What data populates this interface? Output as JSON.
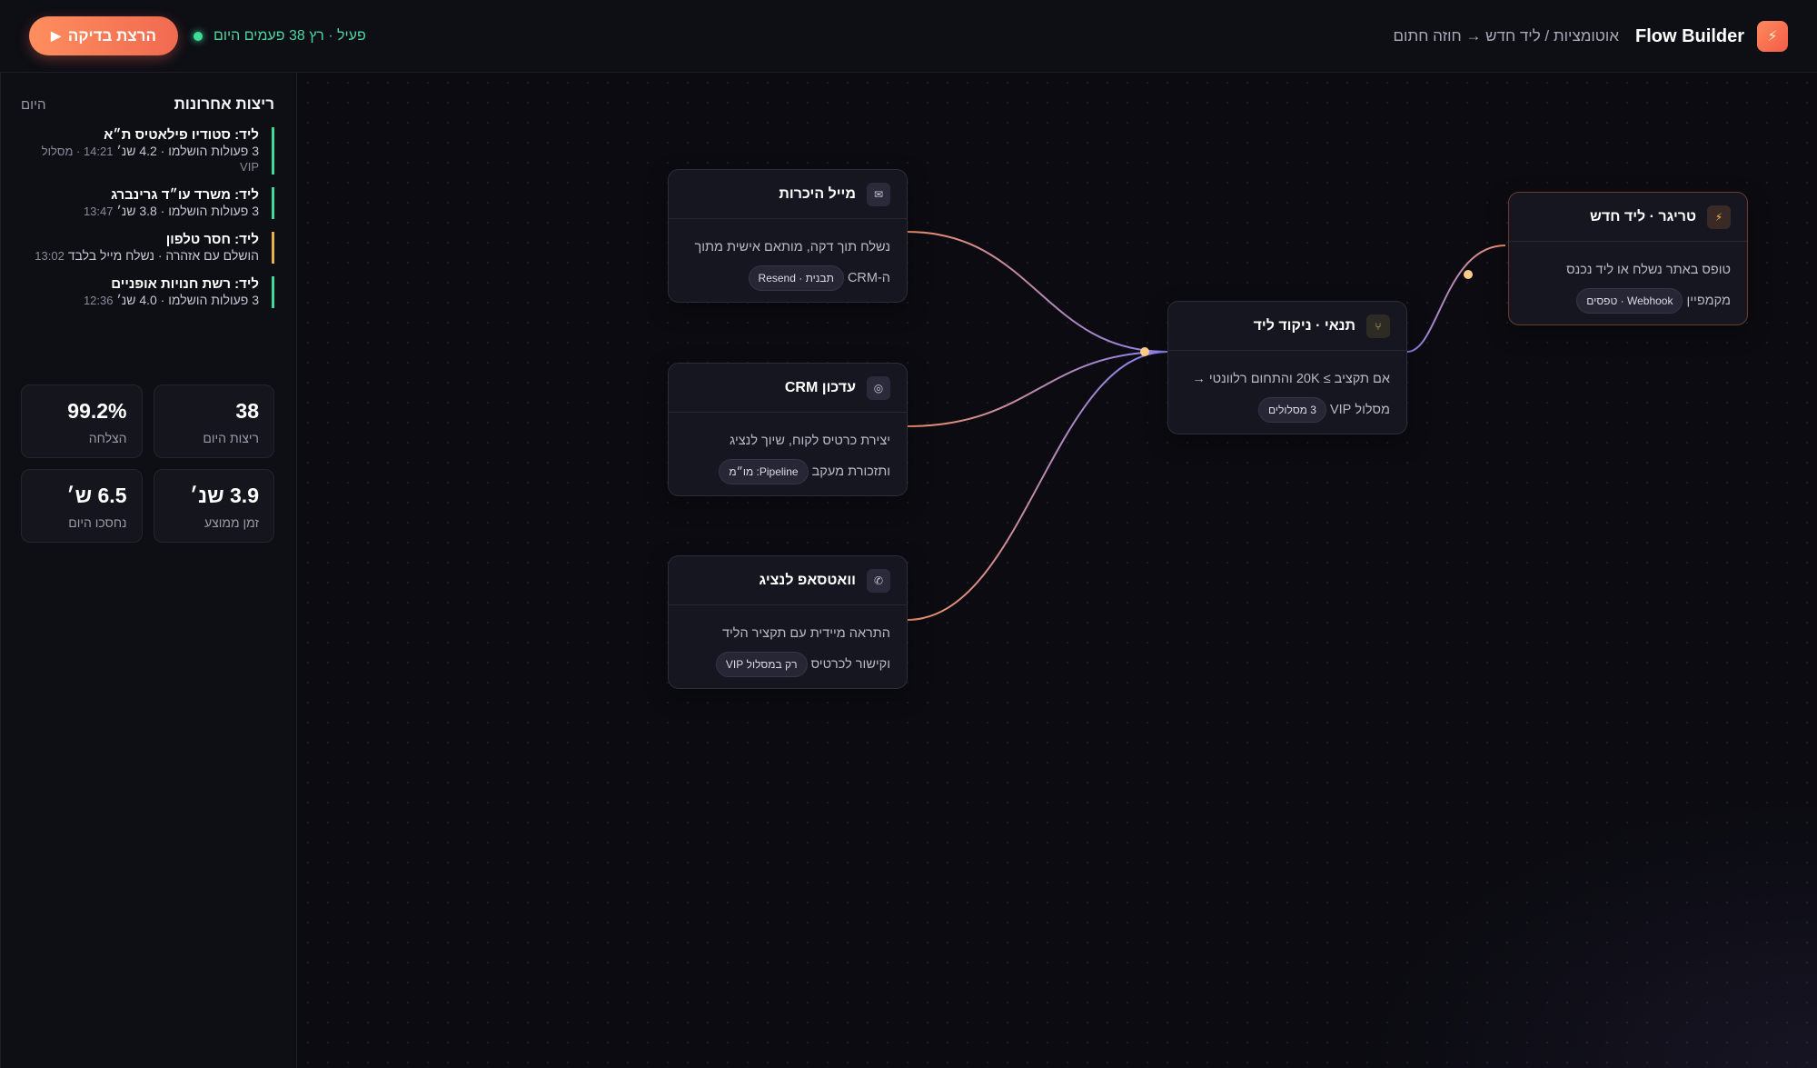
{
  "header": {
    "brand_title": "Flow Builder",
    "brand_icon": "bolt-icon",
    "breadcrumb": "אוטומציות / ליד חדש → חוזה חתום",
    "status_text": "פעיל · רץ 38 פעמים היום",
    "run_button": "הרצת בדיקה",
    "accent_color": "#f06a50",
    "status_color": "#3ddc97"
  },
  "sidebar": {
    "title": "ריצות אחרונות",
    "today": "היום",
    "runs": [
      {
        "name": "ליד: סטודיו פילאטיס ת״א",
        "meta": "3 פעולות הושלמו · 4.2 שנ׳",
        "time": "14:21 · מסלול VIP",
        "status": "success"
      },
      {
        "name": "ליד: משרד עו״ד גרינברג",
        "meta": "3 פעולות הושלמו · 3.8 שנ׳",
        "time": "13:47",
        "status": "success"
      },
      {
        "name": "ליד: חסר טלפון",
        "meta": "הושלם עם אזהרה · נשלח מייל בלבד",
        "time": "13:02",
        "status": "warning"
      },
      {
        "name": "ליד: רשת חנויות אופניים",
        "meta": "3 פעולות הושלמו · 4.0 שנ׳",
        "time": "12:36",
        "status": "success"
      }
    ],
    "stats": [
      {
        "value": "38",
        "label": "ריצות היום"
      },
      {
        "value": "99.2%",
        "label": "הצלחה"
      },
      {
        "value": "3.9 שנ׳",
        "label": "זמן ממוצע"
      },
      {
        "value": "6.5 ש׳",
        "label": "נחסכו היום"
      }
    ]
  },
  "nodes": {
    "trigger": {
      "icon": "bolt-icon",
      "title": "טריגר · ליד חדש",
      "line1": "טופס באתר נשלח או ליד נכנס",
      "line2": "מקמפיין",
      "pill": "Webhook · טפסים"
    },
    "condition": {
      "icon": "branch-icon",
      "title": "תנאי · ניקוד ליד",
      "line1": "אם תקציב ≥ 20K והתחום רלוונטי →",
      "line2": "מסלול VIP",
      "pill": "3 מסלולים"
    },
    "email": {
      "icon": "mail-icon",
      "title": "מייל היכרות",
      "line1": "נשלח תוך דקה, מותאם אישית מתוך",
      "line2": "ה-CRM",
      "pill": "תבנית · Resend"
    },
    "crm": {
      "icon": "crm-icon",
      "title": "עדכון CRM",
      "line1": "יצירת כרטיס לקוח, שיוך לנציג",
      "line2": "ותזכורת מעקב",
      "pill": "Pipeline: מו״מ"
    },
    "whatsapp": {
      "icon": "whatsapp-icon",
      "title": "וואטסאפ לנציג",
      "line1": "התראה מיידית עם תקציר הליד",
      "line2": "וקישור לכרטיס",
      "pill": "רק במסלול VIP"
    }
  }
}
